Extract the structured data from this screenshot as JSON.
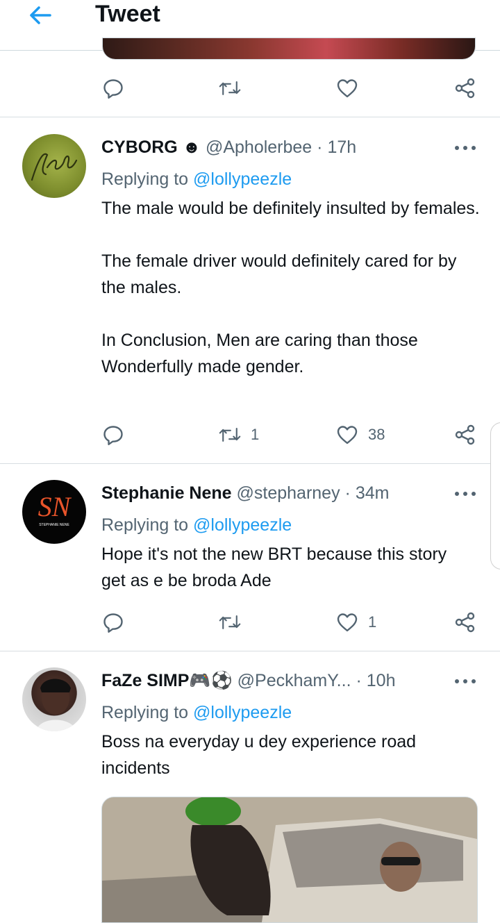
{
  "header": {
    "title": "Tweet"
  },
  "top_actions": {
    "reply_count": "",
    "retweet_count": "",
    "like_count": ""
  },
  "tweets": [
    {
      "name": "CYBORG",
      "name_emoji": "☻",
      "handle": "@Apholerbee",
      "time": "· 17h",
      "replying_prefix": "Replying to",
      "replying_handle": "@lollypeezle",
      "paragraphs": [
        "The male would be definitely insulted by females.",
        "The female driver would definitely cared for by the males.",
        "In Conclusion, Men are caring than those Wonderfully made gender."
      ],
      "reply_count": "",
      "retweet_count": "1",
      "like_count": "38",
      "avatar_text": "Afolabi"
    },
    {
      "name": "Stephanie Nene",
      "handle": "@stepharney",
      "time": "· 34m",
      "replying_prefix": "Replying to",
      "replying_handle": "@lollypeezle",
      "paragraphs": [
        "Hope it's not the new BRT because this story get as e be broda Ade"
      ],
      "reply_count": "",
      "retweet_count": "",
      "like_count": "1",
      "avatar_text": "SN",
      "avatar_subtext": "STEPHANIE NENE"
    },
    {
      "name": "FaZe SIMP",
      "name_emoji": "🎮⚽",
      "handle": "@PeckhamY...",
      "time": "· 10h",
      "replying_prefix": "Replying to",
      "replying_handle": "@lollypeezle",
      "paragraphs": [
        "Boss na everyday u dey experience road incidents"
      ]
    }
  ],
  "colors": {
    "accent": "#1d9bf0",
    "muted": "#536471",
    "divider": "#d7dde1"
  },
  "icons": [
    "back-arrow-icon",
    "reply-icon",
    "retweet-icon",
    "like-icon",
    "share-icon",
    "more-icon"
  ]
}
